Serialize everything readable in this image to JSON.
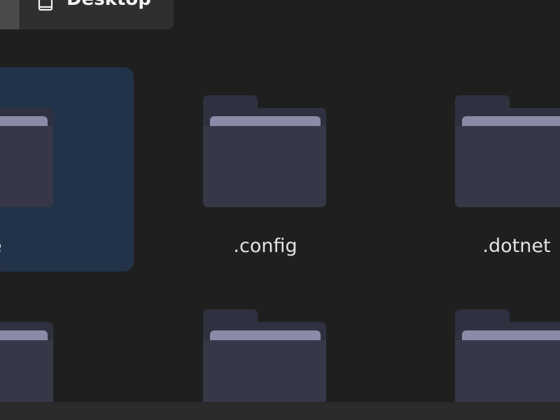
{
  "pathbar": {
    "current_label": "Desktop"
  },
  "items": [
    {
      "label": "ache",
      "selected": true
    },
    {
      "label": ".config",
      "selected": false
    },
    {
      "label": ".dotnet",
      "selected": false
    },
    {
      "label": "",
      "selected": false
    },
    {
      "label": "",
      "selected": false
    },
    {
      "label": "",
      "selected": false
    }
  ],
  "colors": {
    "background": "#1f1f1f",
    "selection": "#223349",
    "folder_body": "#363848",
    "folder_tab": "#2f3140",
    "folder_paper": "#8b8aa8"
  }
}
